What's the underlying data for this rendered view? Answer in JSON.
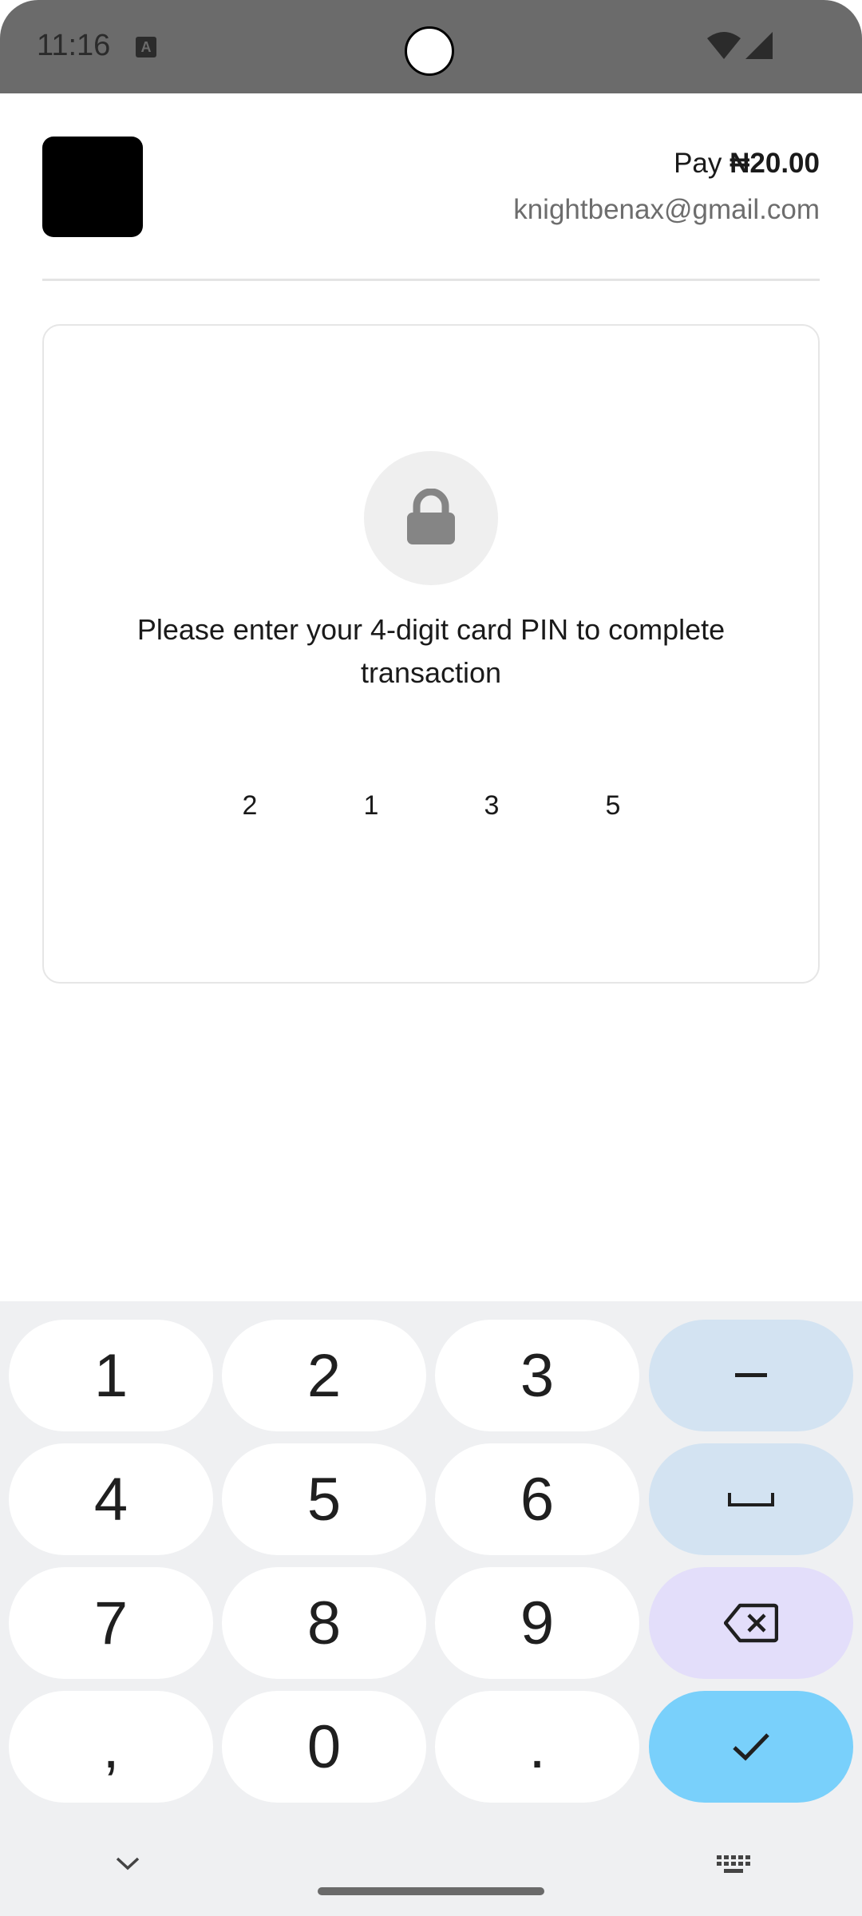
{
  "status_bar": {
    "time": "11:16",
    "notification_icon": "keyboard-a-icon",
    "icons": [
      "wifi-icon",
      "signal-icon"
    ]
  },
  "header": {
    "pay_label": "Pay",
    "amount": "₦20.00",
    "email": "knightbenax@gmail.com"
  },
  "pin_card": {
    "icon": "lock-icon",
    "prompt": "Please enter your 4-digit card PIN to complete transaction",
    "digits": [
      "2",
      "1",
      "3",
      "5"
    ]
  },
  "keyboard": {
    "rows": [
      [
        "1",
        "2",
        "3",
        "−"
      ],
      [
        "4",
        "5",
        "6",
        "␣"
      ],
      [
        "7",
        "8",
        "9",
        "backspace"
      ],
      [
        ",",
        "0",
        ".",
        "done"
      ]
    ],
    "colors": {
      "background": "#eff0f2",
      "key": "#ffffff",
      "function_key": "#d3e3f2",
      "backspace_key": "#e3defa",
      "done_key": "#79d0fb"
    }
  }
}
